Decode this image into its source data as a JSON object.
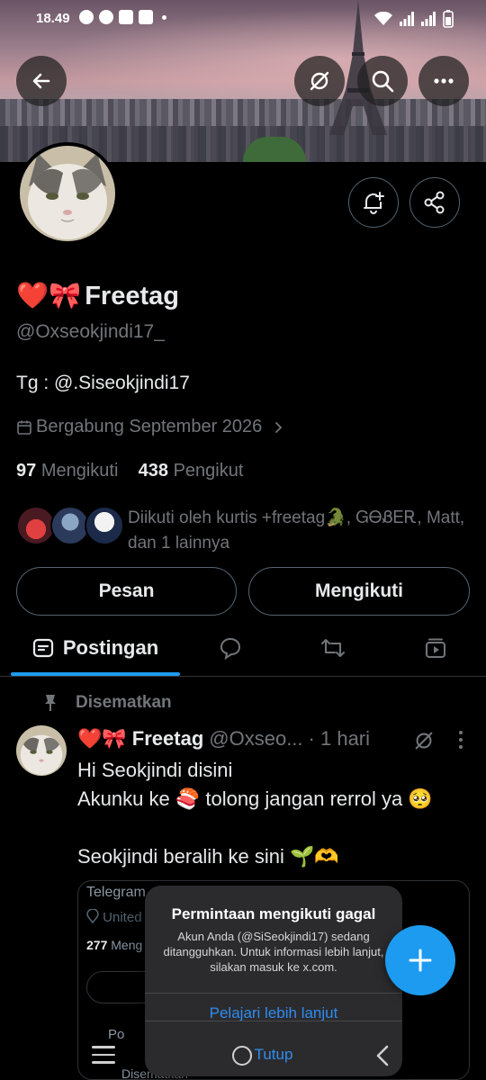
{
  "status_bar": {
    "time": "18.49"
  },
  "header": {
    "back_icon": "arrow-left-icon",
    "grok_icon": "slash-circle-icon",
    "search_icon": "search-icon",
    "more_icon": "more-horizontal-icon",
    "notify_icon": "bell-plus-icon",
    "share_icon": "share-icon"
  },
  "profile": {
    "name": "Freetag",
    "name_emoji": "❤️🎀",
    "handle": "@Oxseokjindi17_",
    "bio": "Tg : @.Siseokjindi17",
    "joined": "Bergabung September 2026",
    "following_count": "97",
    "following_label": "Mengikuti",
    "followers_count": "438",
    "followers_label": "Pengikut",
    "followed_by": "Diikuti oleh kurtis +freetag🐊, ᏀᎾᏰᎬᎡ, Matt, dan 1 lainnya"
  },
  "actions": {
    "message_label": "Pesan",
    "following_label": "Mengikuti"
  },
  "tabs": {
    "active_label": "Postingan"
  },
  "post": {
    "pinned_label": "Disematkan",
    "author_name": "Freetag",
    "author_emoji": "❤️🎀",
    "author_handle": "@Oxseo...",
    "time": "· 1 hari",
    "lines": [
      "Hi Seokjindi disini",
      "Akunku ke 🍣 tolong jangan rerrol ya 🥺",
      "",
      "Seokjindi beralih ke sini 🌱🫶"
    ],
    "card": {
      "line1": "Telegram",
      "line2": "United",
      "line3_count": "277",
      "line3_label": "Meng",
      "line4": "Po",
      "line5": "Disematkan"
    }
  },
  "toast": {
    "title": "Permintaan mengikuti gagal",
    "message": "Akun Anda (@SiSeokjindi17) sedang ditangguhkan. Untuk informasi lebih lanjut, silakan masuk ke x.com.",
    "learn_more": "Pelajari lebih lanjut",
    "close": "Tutup"
  },
  "colors": {
    "accent": "#1d9bf0",
    "background": "#000000",
    "muted": "#71767b"
  }
}
